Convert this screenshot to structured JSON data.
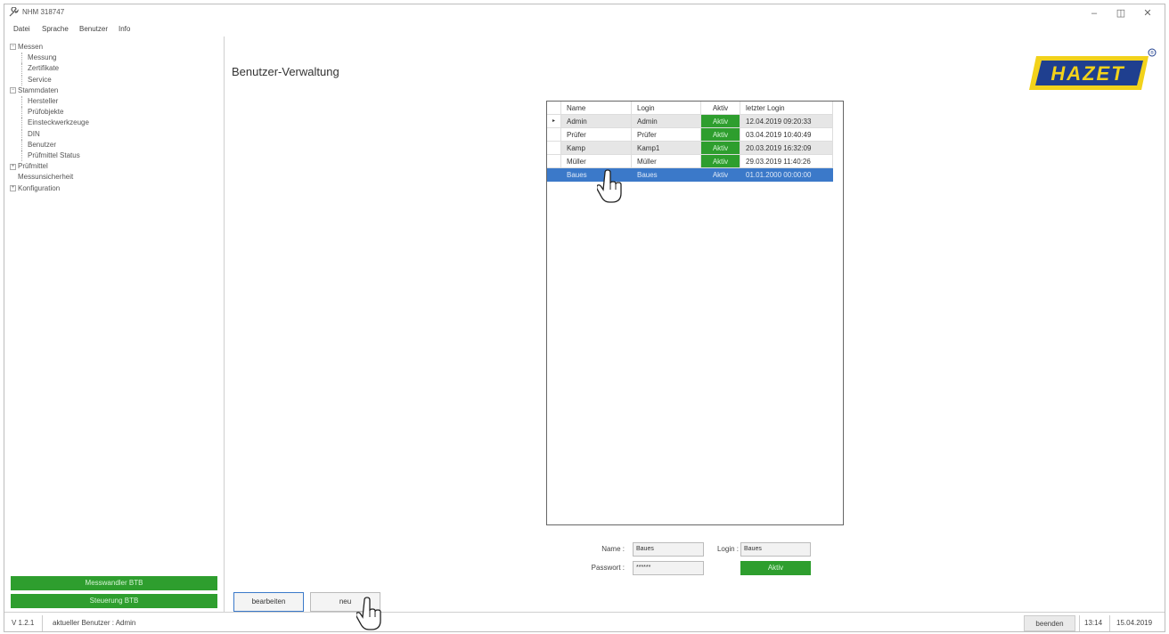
{
  "window": {
    "title": "NHM 318747"
  },
  "menu": [
    "Datei",
    "Sprache",
    "Benutzer",
    "Info"
  ],
  "sidebar": {
    "tree": [
      {
        "label": "Messen",
        "level": 0,
        "expander": "−"
      },
      {
        "label": "Messung",
        "level": 2
      },
      {
        "label": "Zertifikate",
        "level": 2
      },
      {
        "label": "Service",
        "level": 2
      },
      {
        "label": "Stammdaten",
        "level": 0,
        "expander": "−"
      },
      {
        "label": "Hersteller",
        "level": 2
      },
      {
        "label": "Prüfobjekte",
        "level": 2
      },
      {
        "label": "Einsteckwerkzeuge",
        "level": 2
      },
      {
        "label": "DIN",
        "level": 2
      },
      {
        "label": "Benutzer",
        "level": 2
      },
      {
        "label": "Prüfmittel Status",
        "level": 2
      },
      {
        "label": "Prüfmittel",
        "level": 0,
        "expander": "+"
      },
      {
        "label": "Messunsicherheit",
        "level": 1
      },
      {
        "label": "Konfiguration",
        "level": 0,
        "expander": "+"
      }
    ],
    "buttons": {
      "btb1": "Messwandler BTB",
      "btb2": "Steuerung BTB"
    }
  },
  "main": {
    "title": "Benutzer-Verwaltung",
    "logo": "HAZET",
    "grid": {
      "headers": {
        "name": "Name",
        "login": "Login",
        "aktiv": "Aktiv",
        "last": "letzter Login"
      },
      "rows": [
        {
          "marker": "▸",
          "name": "Admin",
          "login": "Admin",
          "aktiv": "Aktiv",
          "last": "12.04.2019 09:20:33"
        },
        {
          "marker": "",
          "name": "Prüfer",
          "login": "Prüfer",
          "aktiv": "Aktiv",
          "last": "03.04.2019 10:40:49"
        },
        {
          "marker": "",
          "name": "Kamp",
          "login": "Kamp1",
          "aktiv": "Aktiv",
          "last": "20.03.2019 16:32:09"
        },
        {
          "marker": "",
          "name": "Müller",
          "login": "Müller",
          "aktiv": "Aktiv",
          "last": "29.03.2019 11:40:26"
        },
        {
          "marker": "",
          "name": "Baues",
          "login": "Baues",
          "aktiv": "Aktiv",
          "last": "01.01.2000 00:00:00"
        }
      ]
    },
    "form": {
      "name_label": "Name :",
      "name_value": "Baues",
      "login_label": "Login :",
      "login_value": "Baues",
      "password_label": "Passwort :",
      "password_value": "******",
      "aktiv_label": "Aktiv"
    },
    "buttons": {
      "edit": "bearbeiten",
      "new": "neu"
    }
  },
  "status": {
    "version": "V 1.2.1",
    "user": "aktueller Benutzer : Admin",
    "exit": "beenden",
    "time": "13:14",
    "date": "15.04.2019"
  },
  "colors": {
    "green": "#2e9e2e",
    "selection": "#3b79c9",
    "logo_yellow": "#f2d21b",
    "logo_blue": "#1f3f8f"
  }
}
